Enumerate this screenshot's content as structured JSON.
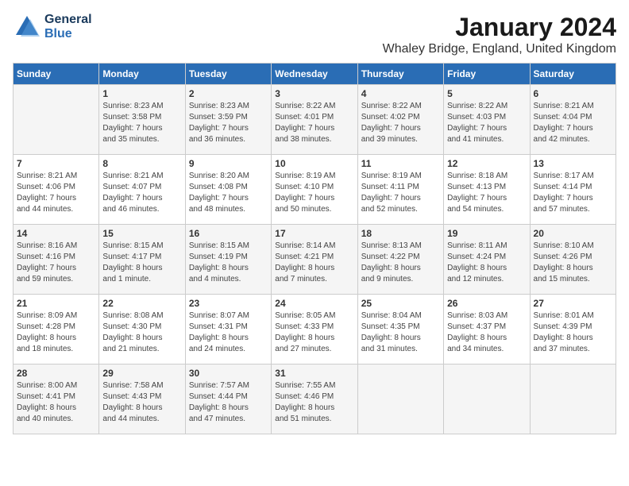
{
  "logo": {
    "line1": "General",
    "line2": "Blue"
  },
  "title": "January 2024",
  "subtitle": "Whaley Bridge, England, United Kingdom",
  "days_of_week": [
    "Sunday",
    "Monday",
    "Tuesday",
    "Wednesday",
    "Thursday",
    "Friday",
    "Saturday"
  ],
  "weeks": [
    [
      {
        "day": "",
        "info": ""
      },
      {
        "day": "1",
        "info": "Sunrise: 8:23 AM\nSunset: 3:58 PM\nDaylight: 7 hours\nand 35 minutes."
      },
      {
        "day": "2",
        "info": "Sunrise: 8:23 AM\nSunset: 3:59 PM\nDaylight: 7 hours\nand 36 minutes."
      },
      {
        "day": "3",
        "info": "Sunrise: 8:22 AM\nSunset: 4:01 PM\nDaylight: 7 hours\nand 38 minutes."
      },
      {
        "day": "4",
        "info": "Sunrise: 8:22 AM\nSunset: 4:02 PM\nDaylight: 7 hours\nand 39 minutes."
      },
      {
        "day": "5",
        "info": "Sunrise: 8:22 AM\nSunset: 4:03 PM\nDaylight: 7 hours\nand 41 minutes."
      },
      {
        "day": "6",
        "info": "Sunrise: 8:21 AM\nSunset: 4:04 PM\nDaylight: 7 hours\nand 42 minutes."
      }
    ],
    [
      {
        "day": "7",
        "info": "Sunrise: 8:21 AM\nSunset: 4:06 PM\nDaylight: 7 hours\nand 44 minutes."
      },
      {
        "day": "8",
        "info": "Sunrise: 8:21 AM\nSunset: 4:07 PM\nDaylight: 7 hours\nand 46 minutes."
      },
      {
        "day": "9",
        "info": "Sunrise: 8:20 AM\nSunset: 4:08 PM\nDaylight: 7 hours\nand 48 minutes."
      },
      {
        "day": "10",
        "info": "Sunrise: 8:19 AM\nSunset: 4:10 PM\nDaylight: 7 hours\nand 50 minutes."
      },
      {
        "day": "11",
        "info": "Sunrise: 8:19 AM\nSunset: 4:11 PM\nDaylight: 7 hours\nand 52 minutes."
      },
      {
        "day": "12",
        "info": "Sunrise: 8:18 AM\nSunset: 4:13 PM\nDaylight: 7 hours\nand 54 minutes."
      },
      {
        "day": "13",
        "info": "Sunrise: 8:17 AM\nSunset: 4:14 PM\nDaylight: 7 hours\nand 57 minutes."
      }
    ],
    [
      {
        "day": "14",
        "info": "Sunrise: 8:16 AM\nSunset: 4:16 PM\nDaylight: 7 hours\nand 59 minutes."
      },
      {
        "day": "15",
        "info": "Sunrise: 8:15 AM\nSunset: 4:17 PM\nDaylight: 8 hours\nand 1 minute."
      },
      {
        "day": "16",
        "info": "Sunrise: 8:15 AM\nSunset: 4:19 PM\nDaylight: 8 hours\nand 4 minutes."
      },
      {
        "day": "17",
        "info": "Sunrise: 8:14 AM\nSunset: 4:21 PM\nDaylight: 8 hours\nand 7 minutes."
      },
      {
        "day": "18",
        "info": "Sunrise: 8:13 AM\nSunset: 4:22 PM\nDaylight: 8 hours\nand 9 minutes."
      },
      {
        "day": "19",
        "info": "Sunrise: 8:11 AM\nSunset: 4:24 PM\nDaylight: 8 hours\nand 12 minutes."
      },
      {
        "day": "20",
        "info": "Sunrise: 8:10 AM\nSunset: 4:26 PM\nDaylight: 8 hours\nand 15 minutes."
      }
    ],
    [
      {
        "day": "21",
        "info": "Sunrise: 8:09 AM\nSunset: 4:28 PM\nDaylight: 8 hours\nand 18 minutes."
      },
      {
        "day": "22",
        "info": "Sunrise: 8:08 AM\nSunset: 4:30 PM\nDaylight: 8 hours\nand 21 minutes."
      },
      {
        "day": "23",
        "info": "Sunrise: 8:07 AM\nSunset: 4:31 PM\nDaylight: 8 hours\nand 24 minutes."
      },
      {
        "day": "24",
        "info": "Sunrise: 8:05 AM\nSunset: 4:33 PM\nDaylight: 8 hours\nand 27 minutes."
      },
      {
        "day": "25",
        "info": "Sunrise: 8:04 AM\nSunset: 4:35 PM\nDaylight: 8 hours\nand 31 minutes."
      },
      {
        "day": "26",
        "info": "Sunrise: 8:03 AM\nSunset: 4:37 PM\nDaylight: 8 hours\nand 34 minutes."
      },
      {
        "day": "27",
        "info": "Sunrise: 8:01 AM\nSunset: 4:39 PM\nDaylight: 8 hours\nand 37 minutes."
      }
    ],
    [
      {
        "day": "28",
        "info": "Sunrise: 8:00 AM\nSunset: 4:41 PM\nDaylight: 8 hours\nand 40 minutes."
      },
      {
        "day": "29",
        "info": "Sunrise: 7:58 AM\nSunset: 4:43 PM\nDaylight: 8 hours\nand 44 minutes."
      },
      {
        "day": "30",
        "info": "Sunrise: 7:57 AM\nSunset: 4:44 PM\nDaylight: 8 hours\nand 47 minutes."
      },
      {
        "day": "31",
        "info": "Sunrise: 7:55 AM\nSunset: 4:46 PM\nDaylight: 8 hours\nand 51 minutes."
      },
      {
        "day": "",
        "info": ""
      },
      {
        "day": "",
        "info": ""
      },
      {
        "day": "",
        "info": ""
      }
    ]
  ]
}
